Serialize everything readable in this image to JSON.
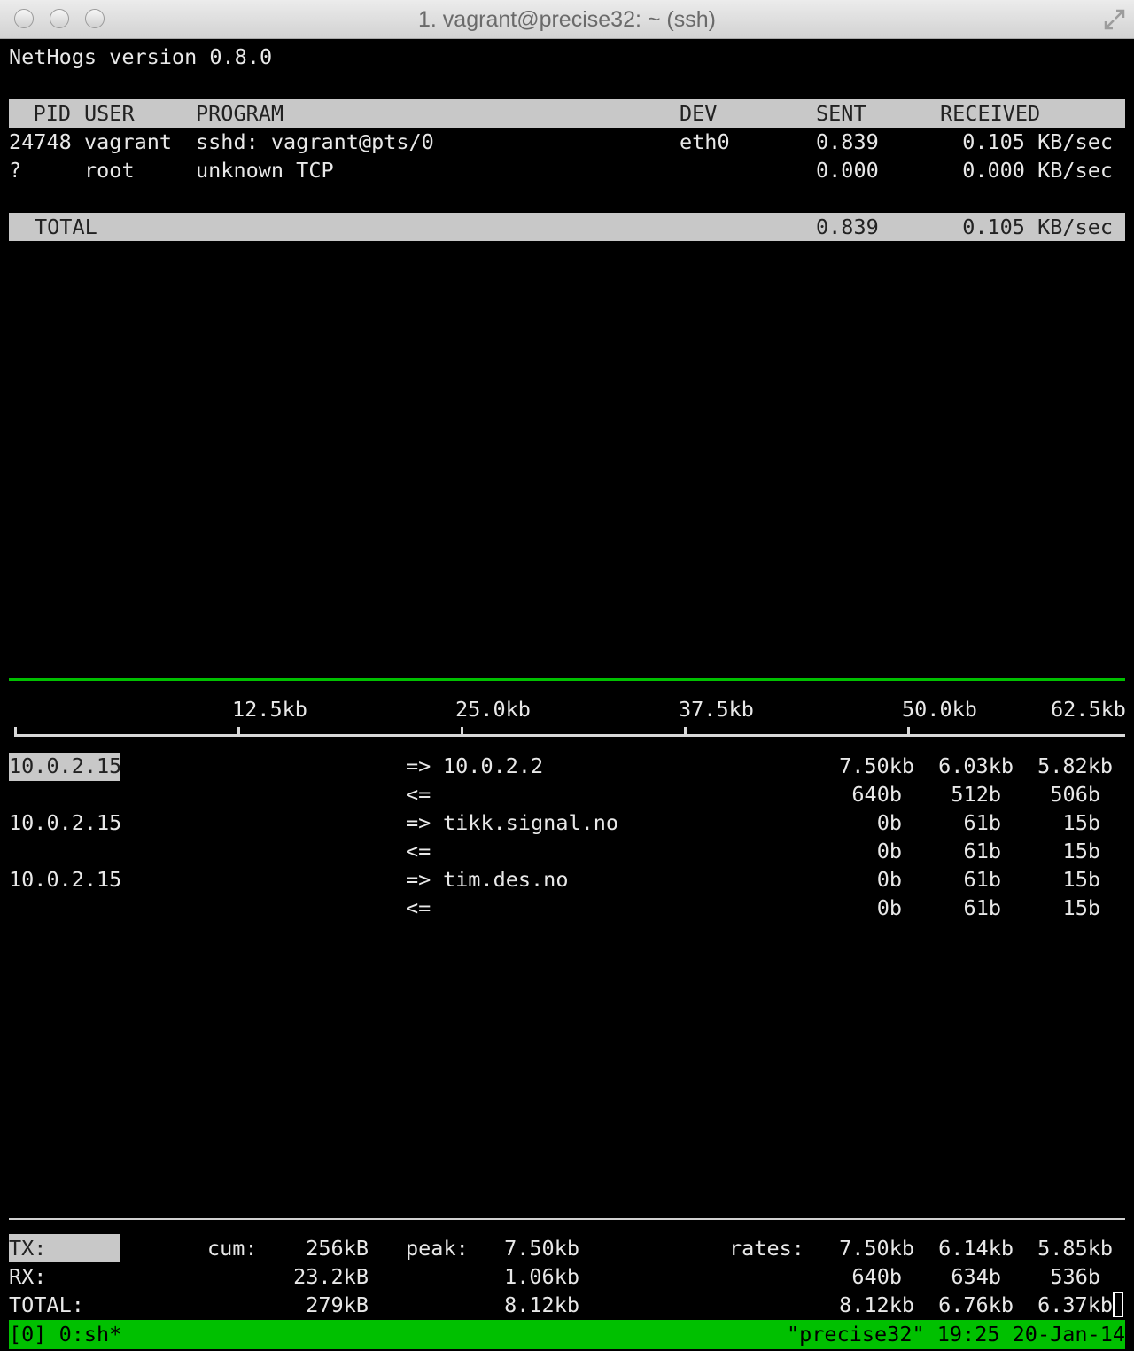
{
  "window": {
    "title": "1. vagrant@precise32: ~ (ssh)"
  },
  "icons": [
    "close-icon",
    "minimize-icon",
    "zoom-icon",
    "fullscreen-icon"
  ],
  "header": {
    "version": "NetHogs version 0.8.0"
  },
  "process_table": {
    "columns": {
      "pid": "PID",
      "user": "USER",
      "program": "PROGRAM",
      "dev": "DEV",
      "sent": "SENT",
      "received": "RECEIVED"
    },
    "rows": [
      {
        "pid": "24748",
        "user": "vagrant",
        "program": "sshd: vagrant@pts/0",
        "dev": "eth0",
        "sent": "0.839",
        "received": "0.105 KB/sec"
      },
      {
        "pid": "?",
        "user": "root",
        "program": "unknown TCP",
        "dev": "",
        "sent": "0.000",
        "received": "0.000 KB/sec"
      }
    ],
    "total": {
      "label": "TOTAL",
      "sent": "0.839",
      "received": "0.105 KB/sec"
    }
  },
  "iftop": {
    "scale": [
      "12.5kb",
      "25.0kb",
      "37.5kb",
      "50.0kb",
      "62.5kb"
    ],
    "flows": [
      {
        "src": "10.0.2.15",
        "out_dir": "=>",
        "dst": "10.0.2.2",
        "out": [
          "7.50kb",
          "6.03kb",
          "5.82kb"
        ],
        "in_dir": "<=",
        "in": [
          "640b",
          "512b",
          "506b"
        ]
      },
      {
        "src": "10.0.2.15",
        "out_dir": "=>",
        "dst": "tikk.signal.no",
        "out": [
          "0b",
          "61b",
          "15b"
        ],
        "in_dir": "<=",
        "in": [
          "0b",
          "61b",
          "15b"
        ]
      },
      {
        "src": "10.0.2.15",
        "out_dir": "=>",
        "dst": "tim.des.no",
        "out": [
          "0b",
          "61b",
          "15b"
        ],
        "in_dir": "<=",
        "in": [
          "0b",
          "61b",
          "15b"
        ]
      }
    ],
    "summary": {
      "cum_label": "cum:",
      "peak_label": "peak:",
      "rates_label": "rates:",
      "tx": {
        "label": "TX:",
        "cum": "256kB",
        "peak": "7.50kb",
        "rates": [
          "7.50kb",
          "6.14kb",
          "5.85kb"
        ]
      },
      "rx": {
        "label": "RX:",
        "cum": "23.2kB",
        "peak": "1.06kb",
        "rates": [
          "640b",
          "634b",
          "536b"
        ]
      },
      "total": {
        "label": "TOTAL:",
        "cum": "279kB",
        "peak": "8.12kb",
        "rates": [
          "8.12kb",
          "6.76kb",
          "6.37kb"
        ]
      }
    }
  },
  "tmux": {
    "window_list": "[0] 0:sh*",
    "right_status": "\"precise32\" 19:25 20-Jan-14"
  }
}
